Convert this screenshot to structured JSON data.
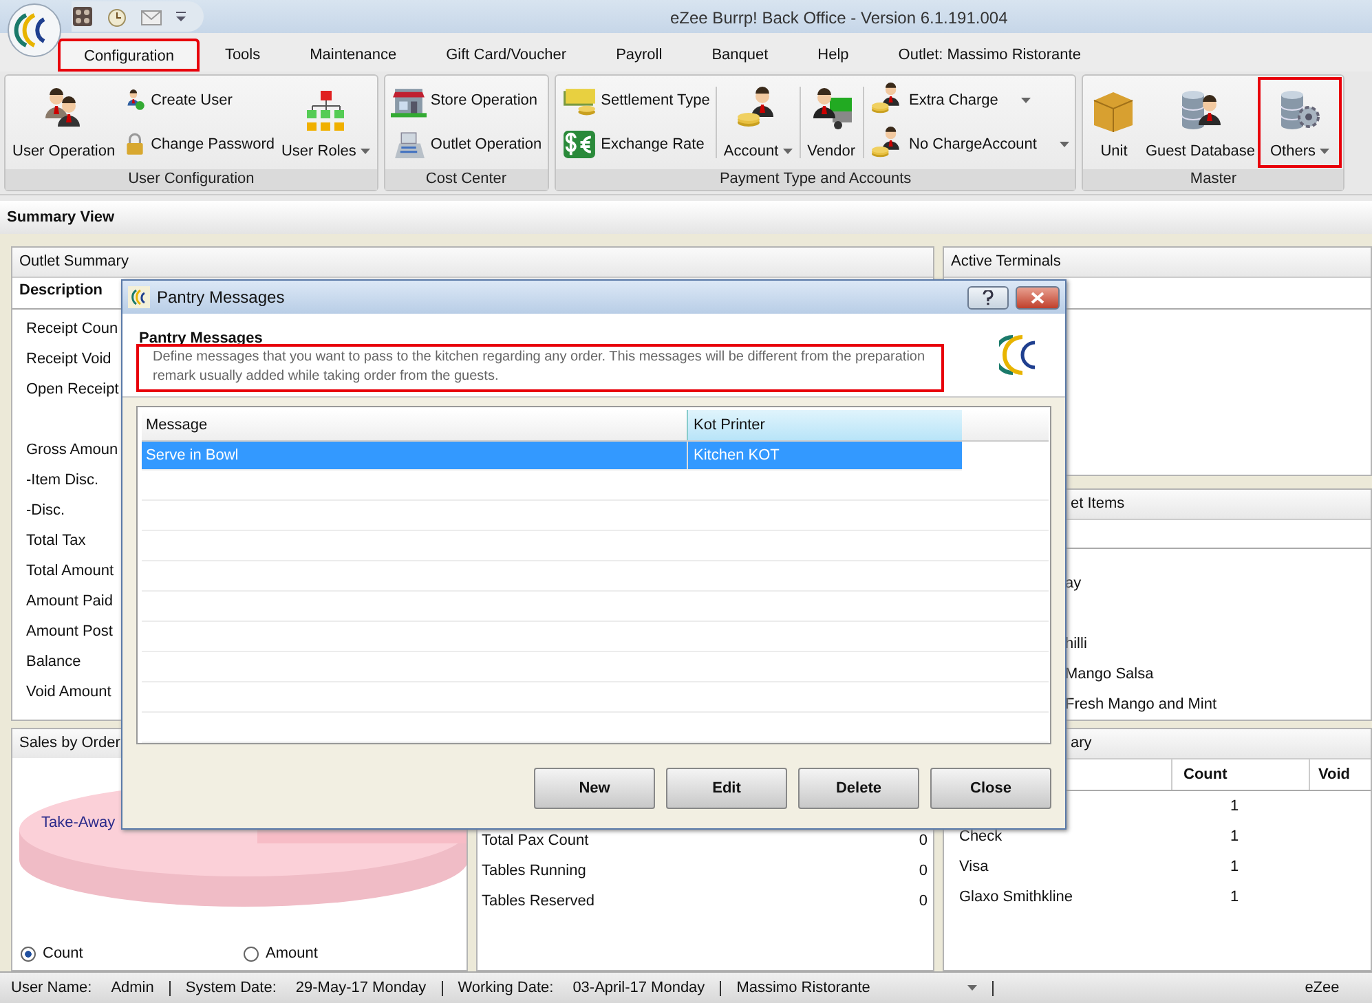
{
  "window": {
    "title": "eZee Burrp! Back Office - Version 6.1.191.004"
  },
  "menu_tabs": [
    {
      "label": "Configuration",
      "selected": true,
      "annotated": true
    },
    {
      "label": "Tools",
      "selected": false,
      "annotated": false
    },
    {
      "label": "Maintenance",
      "selected": false,
      "annotated": false
    },
    {
      "label": "Gift Card/Voucher",
      "selected": false,
      "annotated": false
    },
    {
      "label": "Payroll",
      "selected": false,
      "annotated": false
    },
    {
      "label": "Banquet",
      "selected": false,
      "annotated": false
    },
    {
      "label": "Help",
      "selected": false,
      "annotated": false
    },
    {
      "label": "Outlet: Massimo Ristorante",
      "selected": false,
      "annotated": false
    }
  ],
  "ribbon": [
    {
      "label": "User Configuration",
      "items": [
        {
          "kind": "large",
          "label": "User Operation",
          "dropdown": false,
          "annotated": false
        },
        {
          "kind": "stack",
          "items": [
            {
              "label": "Create User",
              "dropdown": false
            },
            {
              "label": "Change Password",
              "dropdown": false
            }
          ]
        },
        {
          "kind": "large",
          "label": "User Roles",
          "dropdown": true,
          "annotated": false
        }
      ]
    },
    {
      "label": "Cost Center",
      "items": [
        {
          "kind": "stack",
          "items": [
            {
              "label": "Store Operation",
              "dropdown": false
            },
            {
              "label": "Outlet Operation",
              "dropdown": false
            }
          ]
        }
      ]
    },
    {
      "label": "Payment Type and Accounts",
      "items": [
        {
          "kind": "stack",
          "items": [
            {
              "label": "Settlement Type",
              "dropdown": false
            },
            {
              "label": "Exchange Rate",
              "dropdown": false
            }
          ]
        },
        {
          "kind": "large",
          "label": "Account",
          "dropdown": true,
          "annotated": false
        },
        {
          "kind": "large",
          "label": "Vendor",
          "dropdown": false,
          "annotated": false
        },
        {
          "kind": "stack",
          "items": [
            {
              "label": "Extra Charge",
              "dropdown": true
            },
            {
              "label": "No ChargeAccount",
              "dropdown": true
            }
          ]
        }
      ]
    },
    {
      "label": "Master",
      "items": [
        {
          "kind": "large",
          "label": "Unit",
          "dropdown": false,
          "annotated": false
        },
        {
          "kind": "large",
          "label": "Guest Database",
          "dropdown": false,
          "annotated": false
        },
        {
          "kind": "large",
          "label": "Others",
          "dropdown": true,
          "annotated": true
        }
      ]
    }
  ],
  "summary_view": {
    "title": "Summary View"
  },
  "outlet_summary": {
    "title": "Outlet Summary",
    "column_header": "Description",
    "rows": [
      "Receipt Coun",
      "Receipt Void",
      "Open Receipt",
      "Gross Amoun",
      "-Item Disc.",
      "-Disc.",
      "Total Tax",
      "Total Amount",
      "Amount Paid",
      "Amount Post",
      "Balance",
      "Void Amount"
    ]
  },
  "active_terminals": {
    "title": "Active Terminals"
  },
  "top_items": {
    "title": "et Items",
    "rows": [
      "ay",
      "hilli",
      "Mango Salsa",
      "Fresh Mango and Mint"
    ]
  },
  "sales_by_order": {
    "title": "Sales by Order",
    "slice_label": "Take-Away",
    "options": [
      {
        "label": "Count",
        "selected": true
      },
      {
        "label": "Amount",
        "selected": false
      }
    ]
  },
  "table_status": {
    "rows": [
      {
        "label": "Total Pax Count",
        "value": "0"
      },
      {
        "label": "Tables Running",
        "value": "0"
      },
      {
        "label": "Tables Reserved",
        "value": "0"
      }
    ]
  },
  "payment_summary": {
    "title": "ary",
    "columns": [
      "Count",
      "Void"
    ],
    "rows": [
      {
        "count": "1"
      },
      {
        "name": "Check",
        "count": "1"
      },
      {
        "name": "Visa",
        "count": "1"
      },
      {
        "name": "Glaxo Smithkline",
        "count": "1"
      }
    ]
  },
  "dialog": {
    "title": "Pantry Messages",
    "heading": "Pantry Messages",
    "description": "Define messages that you want to pass to the kitchen regarding any order. This messages will be different from the preparation remark usually added while taking order from the guests.",
    "description_annotated": true,
    "columns": [
      "Message",
      "Kot Printer"
    ],
    "rows": [
      {
        "message": "Serve in Bowl",
        "printer": "Kitchen KOT",
        "selected": true
      }
    ],
    "buttons": [
      "New",
      "Edit",
      "Delete",
      "Close"
    ]
  },
  "status_bar": {
    "user_label": "User Name:",
    "user": "Admin",
    "system_date_label": "System Date:",
    "system_date": "29-May-17 Monday",
    "working_date_label": "Working Date:",
    "working_date": "03-April-17 Monday",
    "outlet": "Massimo Ristorante",
    "brand": "eZee"
  }
}
